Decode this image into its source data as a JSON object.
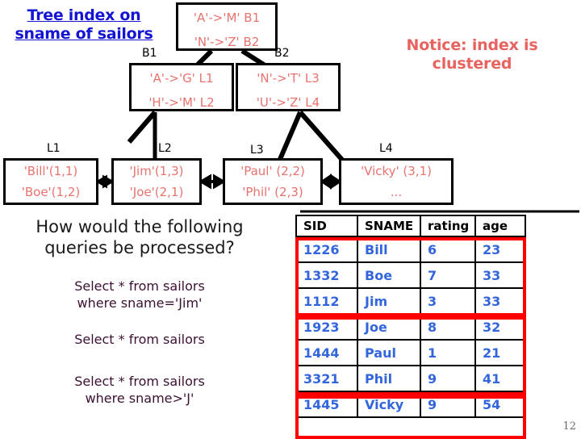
{
  "slide": {
    "title": "Tree index on sname of sailors",
    "title_color": "#1414D2",
    "notice": "Notice: index is clustered",
    "notice_color": "#E8635F",
    "page_number": "12"
  },
  "tree": {
    "root": {
      "label": "",
      "line1": "'A'->'M' B1",
      "line2": "'N'->'Z' B2"
    },
    "internal": [
      {
        "label": "B1",
        "line1": "'A'->'G' L1",
        "line2": "'H'->'M' L2"
      },
      {
        "label": "B2",
        "line1": "'N'->'T' L3",
        "line2": "'U'->'Z' L4"
      }
    ],
    "leaves": [
      {
        "label": "L1",
        "line1": "'Bill'(1,1)",
        "line2": "'Boe'(1,2)"
      },
      {
        "label": "L2",
        "line1": "'Jim'(1,3)",
        "line2": "'Joe'(2,1)"
      },
      {
        "label": "L3",
        "line1": "'Paul' (2,2)",
        "line2": "'Phil' (2,3)"
      },
      {
        "label": "L4",
        "line1": "'Vicky' (3,1)",
        "line2": "..."
      }
    ],
    "node_text_color": "#E8736F",
    "border_color": "#000000"
  },
  "questions": {
    "heading": "How would the following queries be processed?",
    "heading_color": "#1A1A1A",
    "query_color": "#3B1033",
    "items": [
      {
        "line1": "Select * from sailors",
        "line2": "where sname='Jim'"
      },
      {
        "line1": "Select * from sailors",
        "line2": ""
      },
      {
        "line1": "Select * from sailors",
        "line2": "where sname>'J'"
      }
    ]
  },
  "sailors_table": {
    "columns": [
      "SID",
      "SNAME",
      "rating",
      "age"
    ],
    "header_color": "#000000",
    "value_color": "#3366DD",
    "group_highlight_color": "#FF0000",
    "rows": [
      {
        "sid": "1226",
        "sname": "Bill",
        "rating": "6",
        "age": "23"
      },
      {
        "sid": "1332",
        "sname": "Boe",
        "rating": "7",
        "age": "33"
      },
      {
        "sid": "1112",
        "sname": "Jim",
        "rating": "3",
        "age": "33"
      },
      {
        "sid": "1923",
        "sname": "Joe",
        "rating": "8",
        "age": "32"
      },
      {
        "sid": "1444",
        "sname": "Paul",
        "rating": "1",
        "age": "21"
      },
      {
        "sid": "3321",
        "sname": "Phil",
        "rating": "9",
        "age": "41"
      },
      {
        "sid": "1445",
        "sname": "Vicky",
        "rating": "9",
        "age": "54"
      }
    ]
  }
}
